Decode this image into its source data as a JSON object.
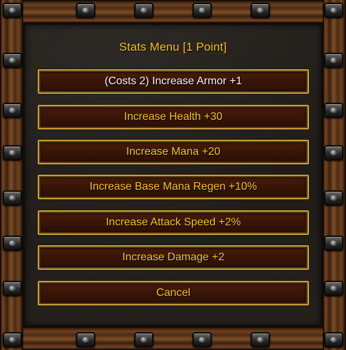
{
  "menu": {
    "title": "Stats Menu [1 Point]",
    "options": [
      {
        "label": "(Costs 2) Increase Armor +1",
        "active": true
      },
      {
        "label": "Increase Health +30"
      },
      {
        "label": "Increase Mana +20"
      },
      {
        "label": "Increase Base Mana Regen +10%"
      },
      {
        "label": "Increase Attack Speed +2%"
      },
      {
        "label": "Increase Damage +2"
      },
      {
        "label": "Cancel"
      }
    ]
  },
  "colors": {
    "text_gold": "#f4c419",
    "text_highlight": "#f3f3f3",
    "button_border": "#c9a23a",
    "button_fill": "#3a1507"
  }
}
